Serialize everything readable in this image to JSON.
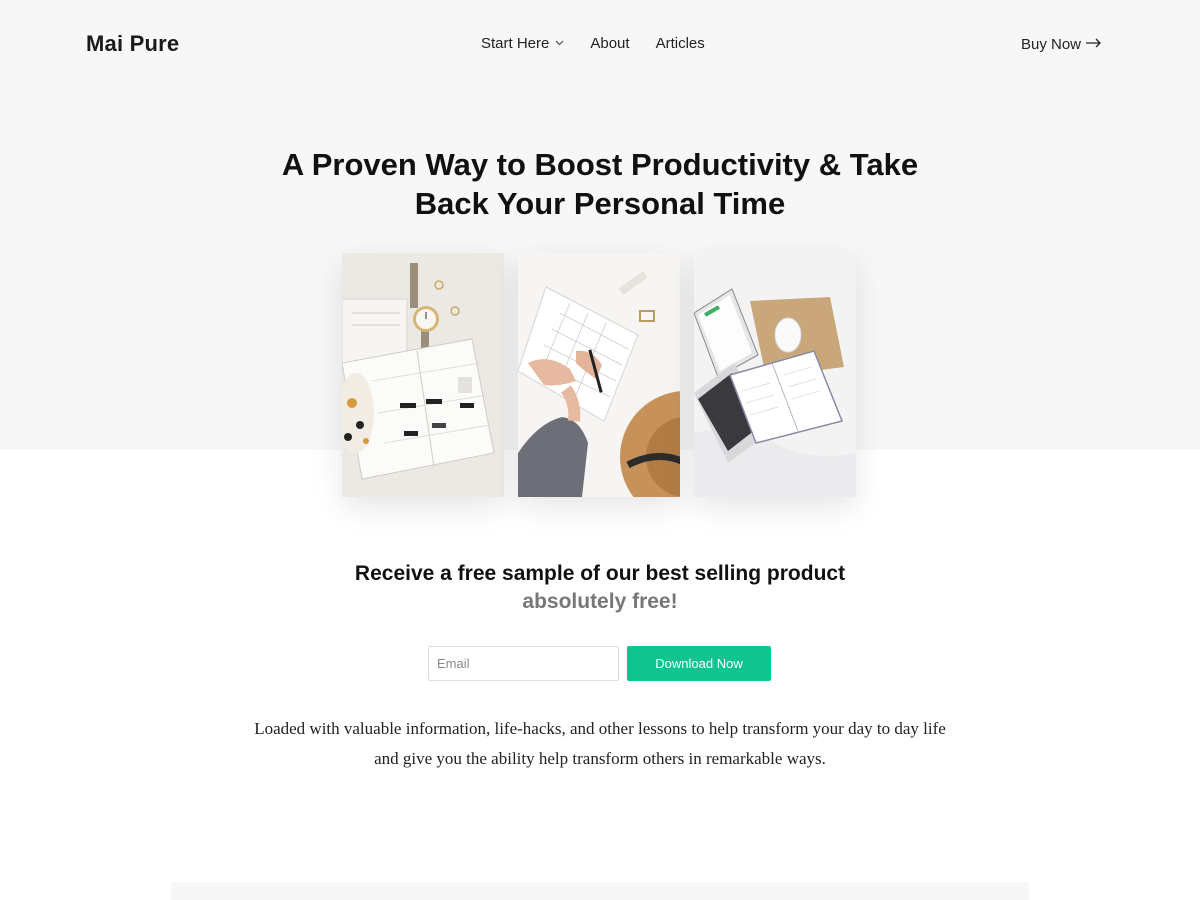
{
  "header": {
    "logo": "Mai Pure",
    "nav": [
      {
        "label": "Start Here",
        "has_dropdown": true
      },
      {
        "label": "About"
      },
      {
        "label": "Articles"
      }
    ],
    "cta_label": "Buy Now",
    "cta_icon": "arrow-right-icon"
  },
  "hero": {
    "title_line1": "A Proven Way to Boost Productivity & Take",
    "title_line2": "Back Your Personal Time",
    "background": "#f7f7f7"
  },
  "gallery": [
    {
      "subject": "planner-and-watch"
    },
    {
      "subject": "hands-writing-calendar"
    },
    {
      "subject": "laptop-and-notebook"
    }
  ],
  "offer": {
    "title": "Receive a free sample of our best selling product",
    "subtitle": "absolutely free!",
    "email_placeholder": "Email",
    "button_label": "Download Now",
    "button_color": "#10c48f",
    "description": "Loaded with valuable information, life-hacks, and other lessons to help transform your day to day life and give you the ability help transform others in remarkable ways."
  }
}
